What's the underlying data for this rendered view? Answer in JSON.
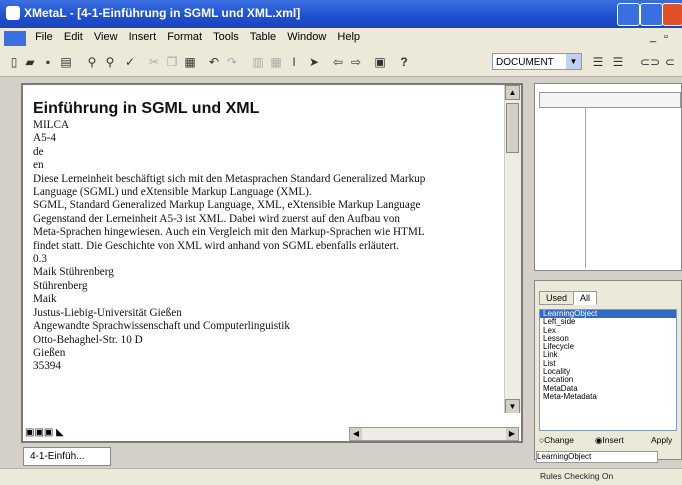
{
  "window": {
    "title": "XMetaL - [4-1-Einführung in SGML und XML.xml]"
  },
  "menu": [
    "File",
    "Edit",
    "View",
    "Insert",
    "Format",
    "Tools",
    "Table",
    "Window",
    "Help"
  ],
  "toolbar": {
    "element_combo": "DOCUMENT",
    "help_label": "?"
  },
  "document": {
    "heading": "Einführung in SGML und XML",
    "lines": [
      "MILCA",
      "A5-4",
      "de",
      "en",
      "Diese Lerneinheit beschäftigt sich mit den Metasprachen Standard Generalized Markup",
      "Language (SGML) und eXtensible Markup Language (XML).",
      "SGML, Standard Generalized Markup Language, XML, eXtensible Markup Language",
      "Gegenstand der Lerneinheit A5-3 ist XML. Dabei wird zuerst auf den Aufbau von",
      "Meta-Sprachen hingewiesen. Auch ein Vergleich mit den Markup-Sprachen wie HTML",
      "findet statt. Die Geschichte von XML wird anhand von SGML ebenfalls erläutert.",
      "0.3",
      "Maik Stührenberg",
      "Stührenberg",
      "Maik",
      "Justus-Liebig-Universität Gießen",
      "Angewandte Sprachwissenschaft und Computerlinguistik",
      "Otto-Behaghel-Str. 10 D",
      "Gießen",
      "35394"
    ],
    "tab_label": "4-1-Einfüh..."
  },
  "elements_panel": {
    "tabs": [
      "Used",
      "All"
    ],
    "items": [
      "LearningObject",
      "Left_side",
      "Lex",
      "Lesson",
      "Lifecycle",
      "Link",
      "List",
      "Locality",
      "Location",
      "MetaData",
      "Meta-Metadata"
    ],
    "selected": "LearningObject",
    "change_label": "Change",
    "insert_label": "Insert",
    "apply_label": "Apply",
    "status": "LearningObject"
  },
  "statusbar": {
    "text": "Rules Checking On"
  }
}
